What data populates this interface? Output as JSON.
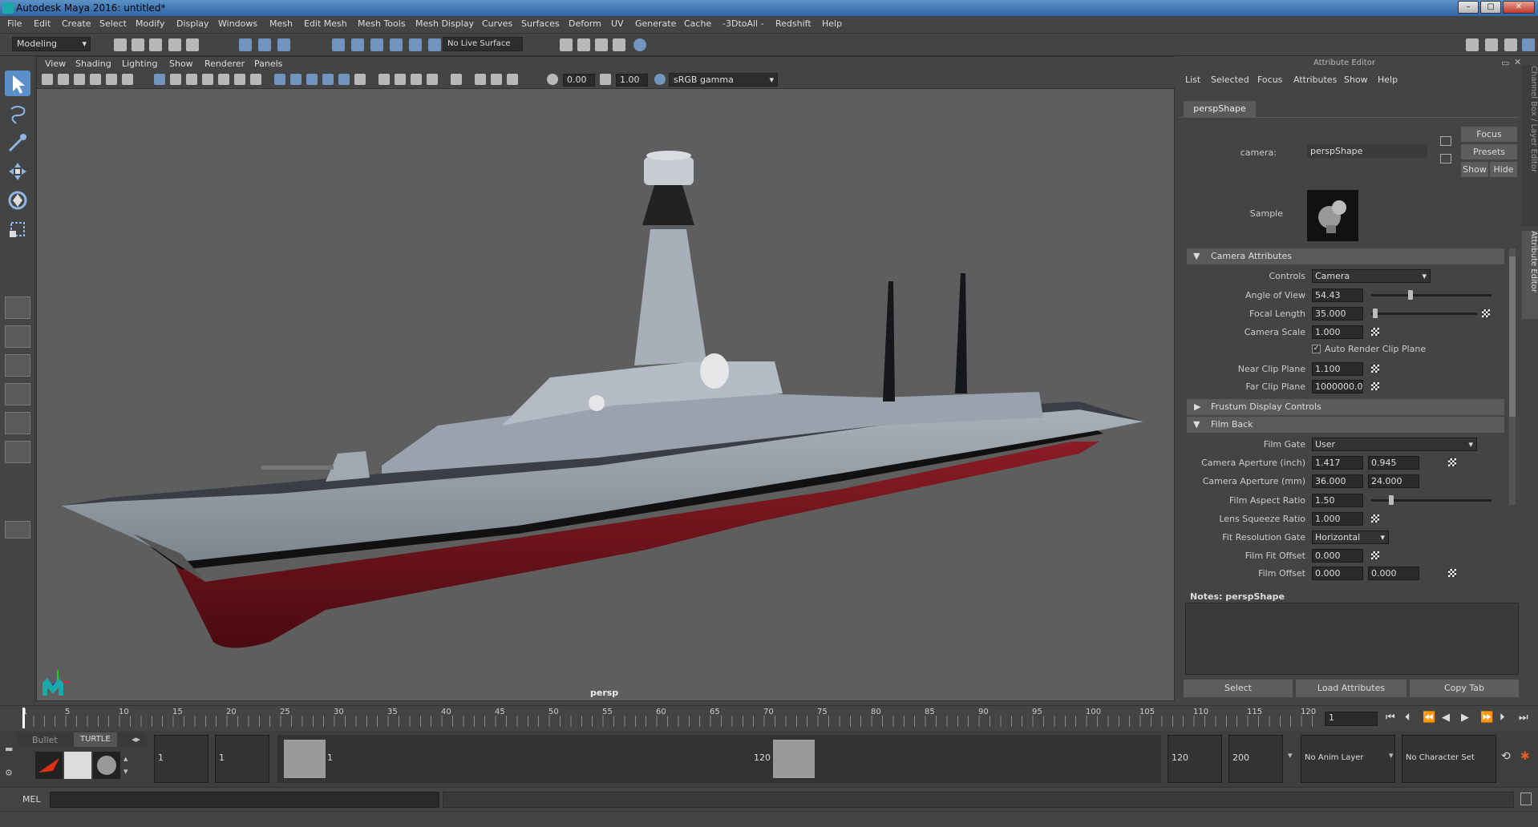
{
  "window": {
    "title": "Autodesk Maya 2016: untitled*"
  },
  "menubar": [
    "File",
    "Edit",
    "Create",
    "Select",
    "Modify",
    "Display",
    "Windows",
    "Mesh",
    "Edit Mesh",
    "Mesh Tools",
    "Mesh Display",
    "Curves",
    "Surfaces",
    "Deform",
    "UV",
    "Generate",
    "Cache",
    "-3DtoAll -",
    "Redshift",
    "Help"
  ],
  "shelf": {
    "mode": "Modeling",
    "live_surface": "No Live Surface"
  },
  "viewport": {
    "menu": [
      "View",
      "Shading",
      "Lighting",
      "Show",
      "Renderer",
      "Panels"
    ],
    "exposure": "0.00",
    "gamma": "1.00",
    "colorspace": "sRGB gamma",
    "camera_label": "persp"
  },
  "attribute_editor": {
    "title": "Attribute Editor",
    "menu": [
      "List",
      "Selected",
      "Focus",
      "Attributes",
      "Show",
      "Help"
    ],
    "tab": "perspShape",
    "camera_label": "camera:",
    "camera_value": "perspShape",
    "buttons": {
      "focus": "Focus",
      "presets": "Presets",
      "show": "Show",
      "hide": "Hide"
    },
    "sample_label": "Sample",
    "side_tabs": [
      "Channel Box / Layer Editor",
      "Attribute Editor"
    ],
    "sections": {
      "camera": "Camera Attributes",
      "frustum": "Frustum Display Controls",
      "filmback": "Film Back"
    },
    "camera_attrs": {
      "controls_label": "Controls",
      "controls": "Camera",
      "aov_label": "Angle of View",
      "aov": "54.43",
      "focal_label": "Focal Length",
      "focal": "35.000",
      "scale_label": "Camera Scale",
      "scale": "1.000",
      "auto_clip": "Auto Render Clip Plane",
      "near_label": "Near Clip Plane",
      "near": "1.100",
      "far_label": "Far Clip Plane",
      "far": "1000000.000"
    },
    "film_back": {
      "gate_label": "Film Gate",
      "gate": "User",
      "ap_inch_label": "Camera Aperture (inch)",
      "ap_inch": [
        "1.417",
        "0.945"
      ],
      "ap_mm_label": "Camera Aperture (mm)",
      "ap_mm": [
        "36.000",
        "24.000"
      ],
      "ratio_label": "Film Aspect Ratio",
      "ratio": "1.50",
      "squeeze_label": "Lens Squeeze Ratio",
      "squeeze": "1.000",
      "fitgate_label": "Fit Resolution Gate",
      "fitgate": "Horizontal",
      "fitoffset_label": "Film Fit Offset",
      "fitoffset": "0.000",
      "offset_label": "Film Offset",
      "offset": [
        "0.000",
        "0.000"
      ]
    },
    "notes_label": "Notes:  perspShape",
    "bottom": {
      "select": "Select",
      "load": "Load Attributes",
      "copy": "Copy Tab"
    }
  },
  "timeline": {
    "ticks": [
      "1",
      "5",
      "10",
      "15",
      "20",
      "25",
      "30",
      "35",
      "40",
      "45",
      "50",
      "55",
      "60",
      "65",
      "70",
      "75",
      "80",
      "85",
      "90",
      "95",
      "100",
      "105",
      "110",
      "115",
      "120"
    ],
    "current_frame": "1"
  },
  "range": {
    "shelf_tabs": [
      "Bullet",
      "TURTLE"
    ],
    "start": "1",
    "inner_start": "1",
    "slider_start": "1",
    "slider_end": "120",
    "end": "120",
    "outer_end": "200",
    "anim_layer": "No Anim Layer",
    "char_set": "No Character Set"
  },
  "command": {
    "lang": "MEL"
  }
}
